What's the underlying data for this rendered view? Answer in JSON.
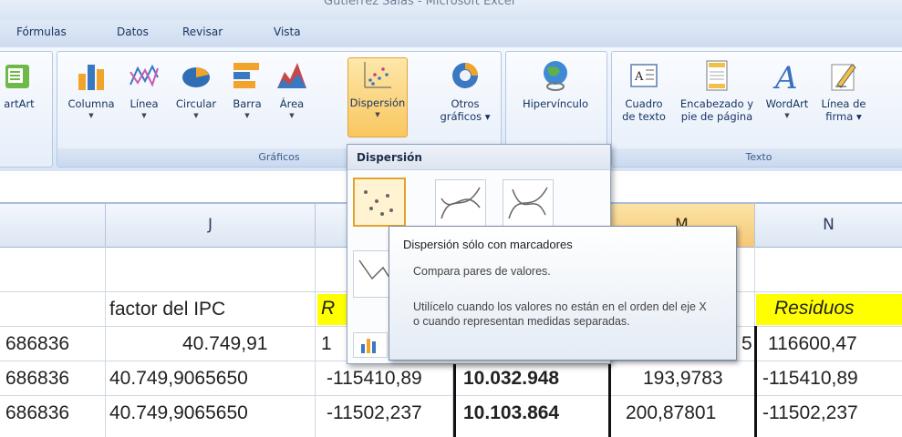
{
  "window": {
    "title": "Gutierrez Salas - Microsoft Excel"
  },
  "tabs": [
    {
      "label": "Fórmulas"
    },
    {
      "label": "Datos"
    },
    {
      "label": "Revisar"
    },
    {
      "label": "Vista"
    }
  ],
  "ribbon": {
    "groups": {
      "graficos": "Gráficos",
      "texto": "Texto"
    },
    "buttons": {
      "smartart": "artArt",
      "columna": "Columna",
      "linea": "Línea",
      "circular": "Circular",
      "barra": "Barra",
      "area": "Área",
      "dispersion": "Dispersión",
      "otros_1": "Otros",
      "otros_2": "gráficos ▾",
      "hipervinculo": "Hipervínculo",
      "cuadro_1": "Cuadro",
      "cuadro_2": "de texto",
      "encabezado_1": "Encabezado y",
      "encabezado_2": "pie de página",
      "wordart": "WordArt",
      "firma_1": "Línea de",
      "firma_2": "firma ▾"
    }
  },
  "dropdown": {
    "title": "Dispersión"
  },
  "tooltip": {
    "title": "Dispersión sólo con marcadores",
    "line1": "Compara pares de valores.",
    "line2": "Utilícelo cuando los valores no están en el orden del eje X o cuando representan medidas separadas."
  },
  "sheet": {
    "columns": [
      "J",
      "M",
      "N"
    ],
    "row_header_label": "factor del IPC",
    "col_k_header_partial": "R",
    "col_n_header": "Residuos",
    "rows": [
      {
        "i": "686836",
        "j": "40.749,91",
        "k": "1",
        "l": "",
        "m": "5",
        "n": "116600,47"
      },
      {
        "i": "686836",
        "j": "40.749,9065650",
        "k": "-115410,89",
        "l": "10.032.948",
        "m": "193,9783",
        "n": "-115410,89"
      },
      {
        "i": "686836",
        "j": "40.749,9065650",
        "k": "-11502,237",
        "l": "10.103.864",
        "m": "200,87801",
        "n": "-11502,237"
      }
    ]
  },
  "colors": {
    "ribbon_bg": "#dfe8f5",
    "selection_yellow": "#ffff00",
    "active_orange": "#f9c760"
  }
}
